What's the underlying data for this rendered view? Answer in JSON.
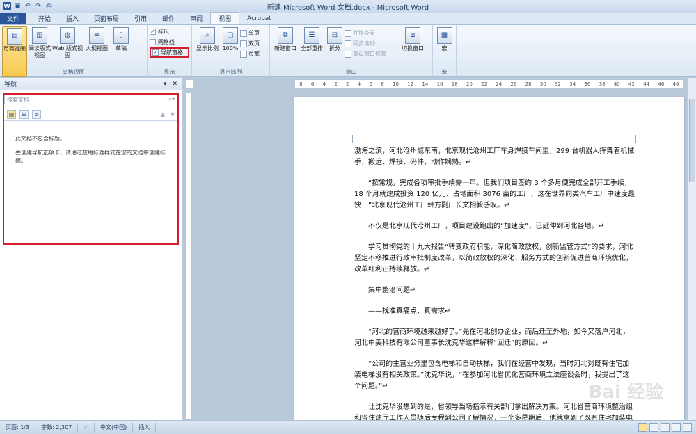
{
  "window": {
    "title": "新建 Microsoft Word 文档.docx - Microsoft Word"
  },
  "quick_access": {
    "word_logo": "W",
    "items": [
      "save-icon",
      "undo-icon",
      "redo-icon",
      "print-icon"
    ]
  },
  "tabs": [
    "文件",
    "开始",
    "插入",
    "页面布局",
    "引用",
    "邮件",
    "审阅",
    "视图",
    "Acrobat"
  ],
  "ribbon": {
    "doc_views": {
      "label": "文档视图",
      "buttons": [
        "页面视图",
        "阅读版式视图",
        "Web 版式视图",
        "大纲视图",
        "草稿"
      ]
    },
    "show": {
      "label": "显示",
      "ruler": "标尺",
      "gridlines": "网格线",
      "nav_pane": "导航窗格"
    },
    "zoom": {
      "label": "显示比例",
      "zoom_btn": "显示比例",
      "percent": "100%",
      "one_page": "单页",
      "two_pages": "双页",
      "page_width": "页宽"
    },
    "window_group": {
      "label": "窗口",
      "new_window": "新建窗口",
      "arrange_all": "全部重排",
      "split": "拆分",
      "side_by_side": "并排查看",
      "sync_scroll": "同步滚动",
      "reset_pos": "重设窗口位置",
      "switch_windows": "切换窗口"
    },
    "macros": {
      "label": "宏",
      "button": "宏"
    }
  },
  "nav": {
    "title": "导航",
    "search_placeholder": "搜索文档",
    "msg1": "此文档不包含标题。",
    "msg2": "要创建导航选项卡，请通过应用标题样式在您的文档中创建标题。"
  },
  "doc": {
    "p1": "渤海之滨，河北沧州城东南，北京现代沧州工厂车身焊接车间里，299 台机器人挥舞着机械手，搬运、焊接、码件，动作娴熟。↵",
    "p2": "“按常规，完成各项审批手续需一年。但我们项目签约 3 个多月便完成全部开工手续，18 个月就建成投资 120 亿元、占地面积 3076 亩的工厂，这在世界同类汽车工厂中速度最快！”北京现代沧州工厂韩方副厂长文相毅感叹。↵",
    "p3": "不仅是北京现代沧州工厂，项目建设跑出的“加速度”，已延伸到河北各地。↵",
    "p4": "学习贯彻党的十九大报告“转变政府职能，深化简政放权，创新监管方式”的要求，河北坚定不移推进行政审批制度改革，以简政放权的深化、服务方式的创新促进营商环境优化，改革红利正持续释放。↵",
    "p5": "集中整治问题↵",
    "p6": "——找准真痛点、真需求↵",
    "p7": "“河北的营商环境越来越好了。”先在河北创办企业，而后迁至外地，如今又落户河北，河北中美科技有限公司董事长沈克华这样解释“回迁”的原因。↵",
    "p8": "“公司的主营业务里包含电梯和自动扶梯，我们在经营中发现，当时河北对既有住宅加装电梯没有相关政策。”沈克华说，“在参加河北省优化营商环境立法座谈会时，我提出了这个问题。”↵",
    "p9": "让沈克华没想到的是，省领导当场指示有关部门拿出解决方案。河北省营商环境整治组和省住建厅工作人员随后专程到公司了解情况，一个多星期后，他就拿到了既有住宅加装电"
  },
  "ruler": {
    "marks": [
      "8",
      "6",
      "4",
      "2",
      "2",
      "4",
      "6",
      "8",
      "10",
      "12",
      "14",
      "16",
      "18",
      "20",
      "22",
      "24",
      "26",
      "28",
      "30",
      "32",
      "34",
      "36",
      "38",
      "40",
      "42",
      "44",
      "46",
      "48"
    ]
  },
  "status": {
    "page": "页面: 1/3",
    "words": "字数: 2,307",
    "lang": "中文(中国)",
    "mode": "插入"
  },
  "watermark": "Bai 经验",
  "colors": {
    "file_tab": "#2a5699",
    "highlight": "#d61d2b",
    "selected": "#fbe49a"
  }
}
